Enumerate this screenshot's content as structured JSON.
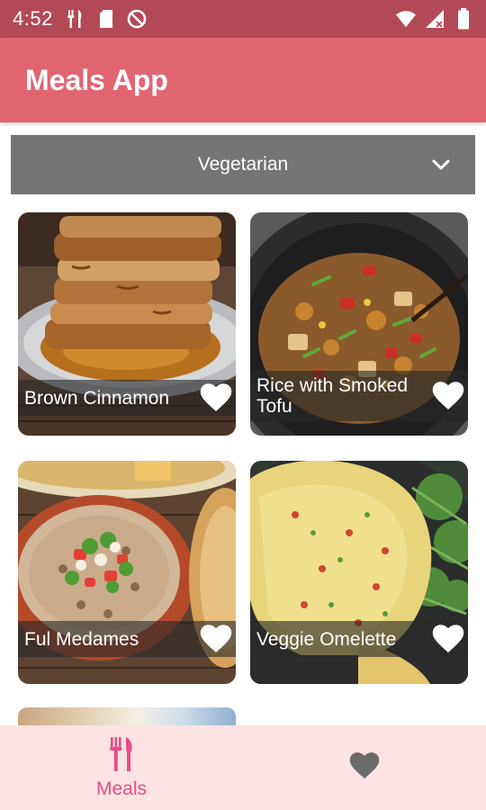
{
  "status_bar": {
    "time": "4:52",
    "left_icons": [
      "fork-knife-icon",
      "sd-card-icon",
      "do-not-disturb-icon"
    ],
    "right_icons": [
      "wifi-icon",
      "signal-icon",
      "battery-icon"
    ]
  },
  "app_bar": {
    "title": "Meals App"
  },
  "filter": {
    "selected": "Vegetarian",
    "icon": "chevron-down-icon"
  },
  "meals": [
    {
      "title": "Brown Cinnamon",
      "favorite_icon": "heart-icon"
    },
    {
      "title": "Rice with Smoked Tofu",
      "favorite_icon": "heart-icon"
    },
    {
      "title": "Ful Medames",
      "favorite_icon": "heart-icon"
    },
    {
      "title": "Veggie Omelette",
      "favorite_icon": "heart-icon"
    }
  ],
  "bottom_nav": {
    "items": [
      {
        "label": "Meals",
        "icon": "fork-knife-icon",
        "active": true
      },
      {
        "label": "",
        "icon": "heart-icon",
        "active": false
      }
    ]
  },
  "colors": {
    "status_bar": "#b24a55",
    "app_bar": "#e16570",
    "dropdown": "#757575",
    "bottom_nav": "#fde3e3",
    "accent": "#e94c8b"
  }
}
